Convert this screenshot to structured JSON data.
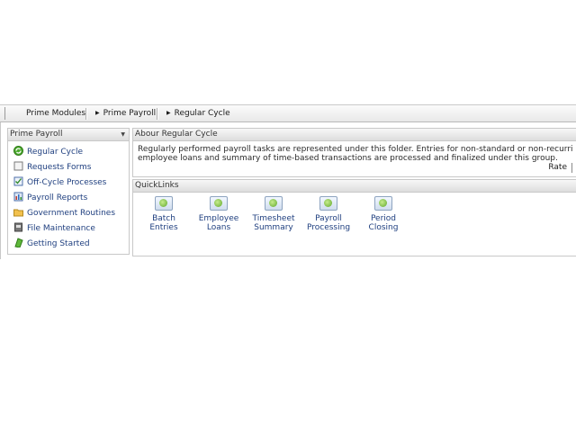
{
  "breadcrumb": {
    "items": [
      "Prime Modules",
      "Prime Payroll",
      "Regular Cycle"
    ]
  },
  "sidebar": {
    "title": "Prime Payroll",
    "items": [
      {
        "label": "Regular Cycle",
        "icon": "green-cycle-icon"
      },
      {
        "label": "Requests Forms",
        "icon": "form-icon"
      },
      {
        "label": "Off-Cycle Processes",
        "icon": "checkbox-icon"
      },
      {
        "label": "Payroll Reports",
        "icon": "report-icon"
      },
      {
        "label": "Government Routines",
        "icon": "folder-icon"
      },
      {
        "label": "File Maintenance",
        "icon": "file-icon"
      },
      {
        "label": "Getting Started",
        "icon": "green-flag-icon"
      }
    ]
  },
  "about": {
    "title": "Abour Regular Cycle",
    "line1": "Regularly performed payroll tasks are represented under this folder.  Entries for non-standard or non-recurring payro",
    "line2": "employee loans and summary of time-based transactions are processed and finalized under this group.",
    "rate_label": "Rate"
  },
  "quicklinks": {
    "title": "QuickLinks",
    "items": [
      {
        "line1": "Batch",
        "line2": "Entries"
      },
      {
        "line1": "Employee",
        "line2": "Loans"
      },
      {
        "line1": "Timesheet",
        "line2": "Summary"
      },
      {
        "line1": "Payroll",
        "line2": "Processing"
      },
      {
        "line1": "Period",
        "line2": "Closing"
      }
    ]
  },
  "colors": {
    "link": "#1f3f7f",
    "icon_green": "#5fa82a",
    "panel_border": "#c8c8c8"
  }
}
